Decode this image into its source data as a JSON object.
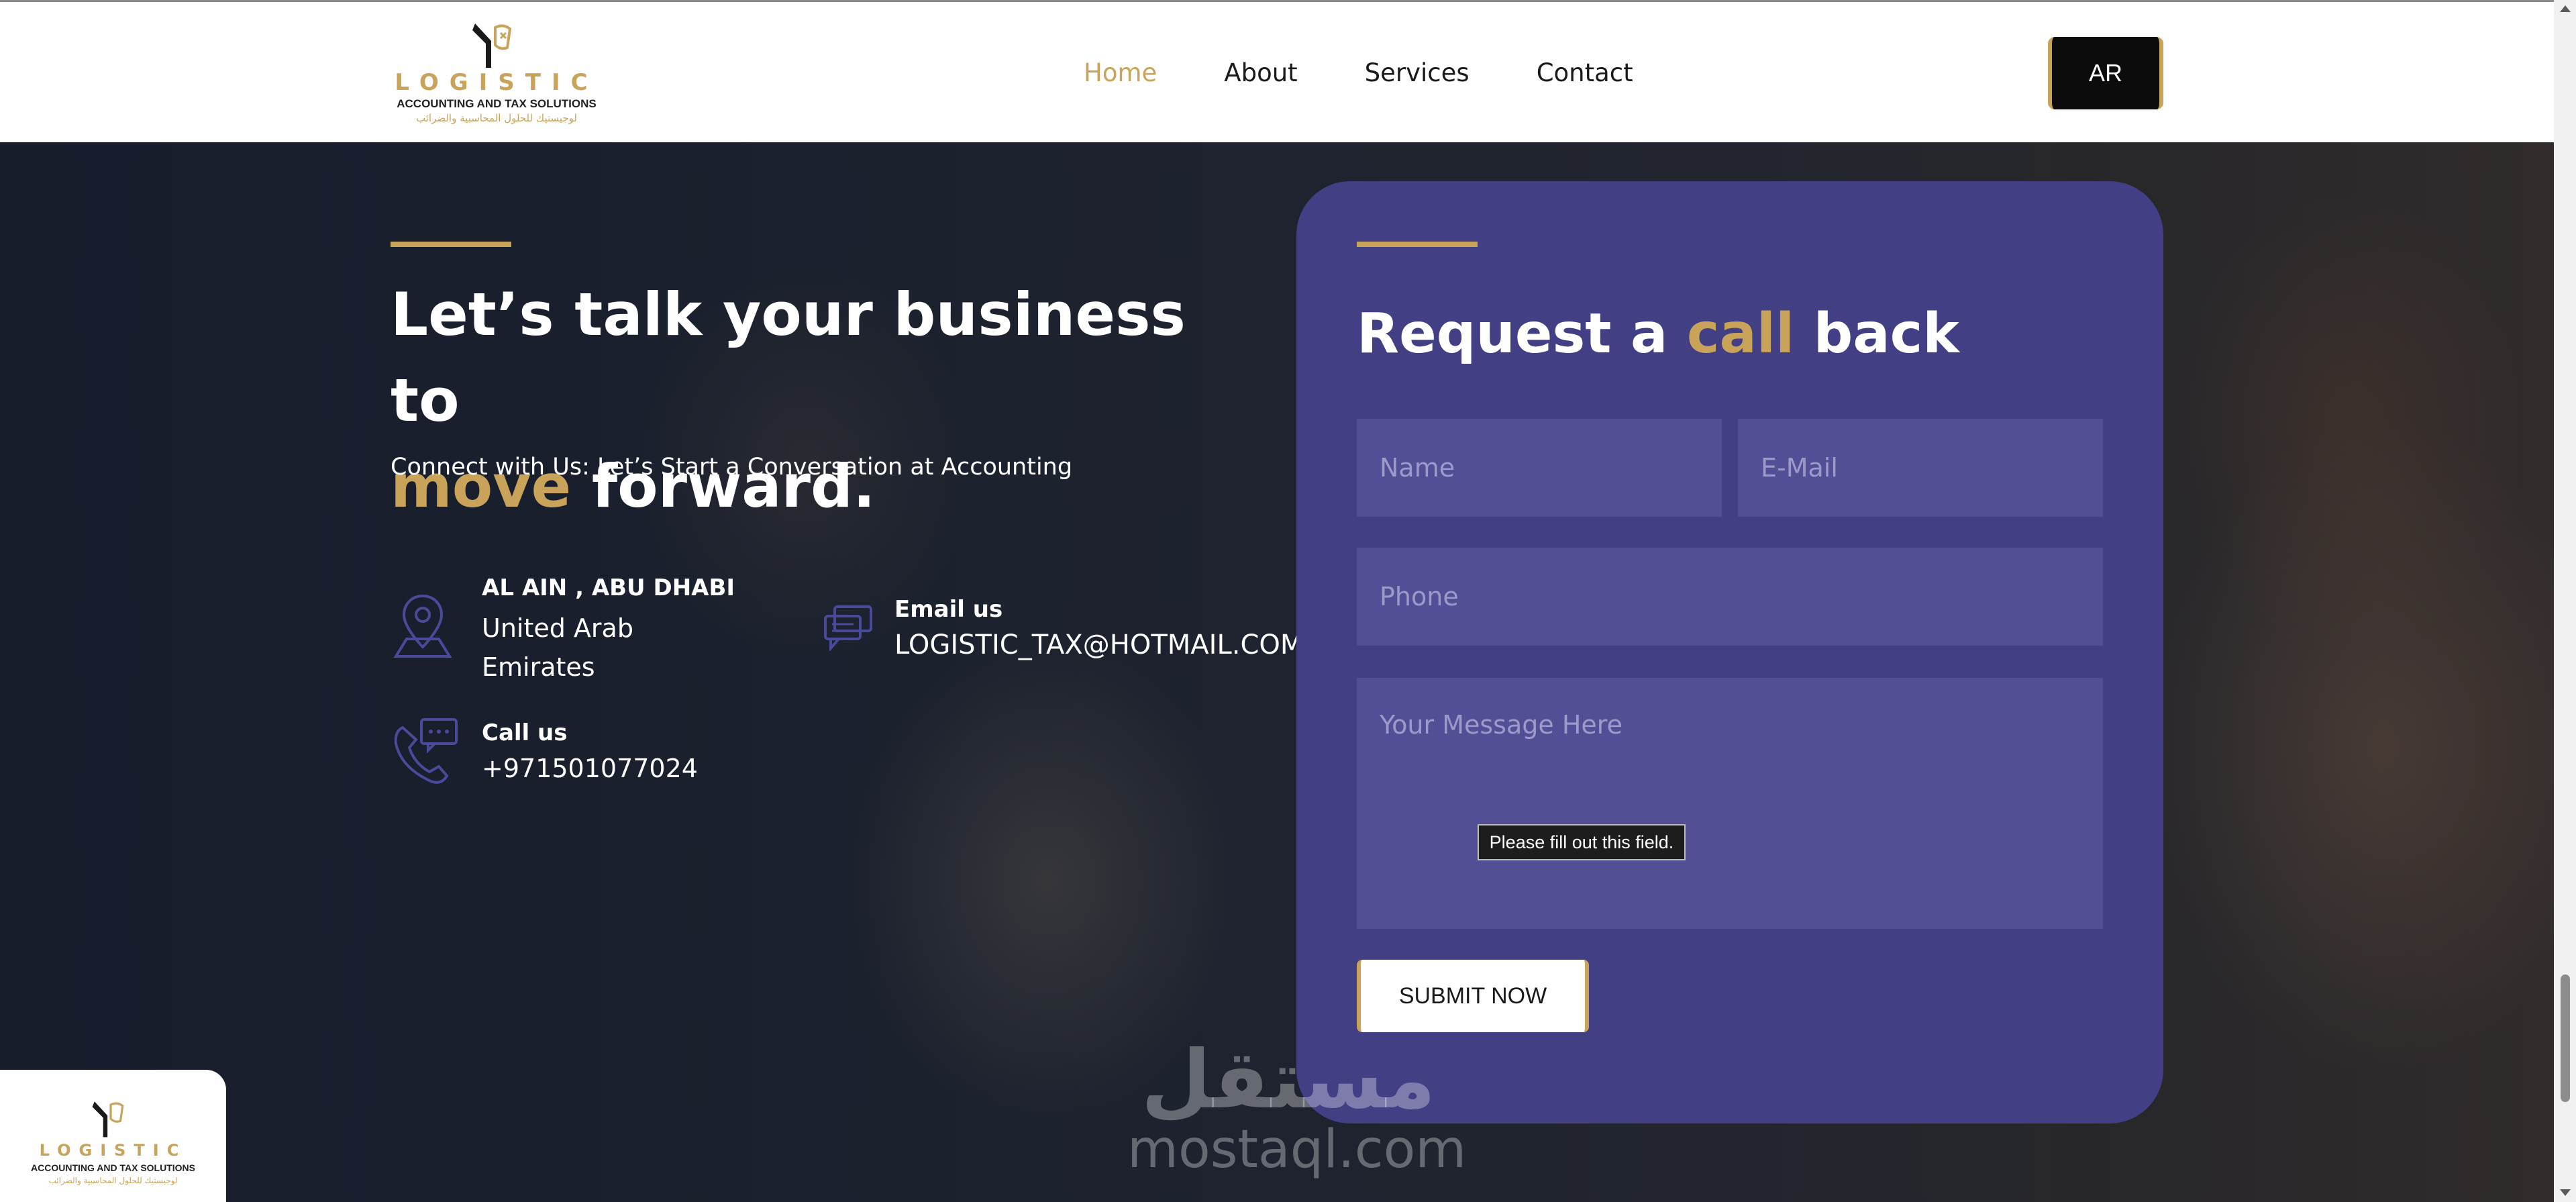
{
  "header": {
    "logo": {
      "word": "LOGISTIC",
      "subtitle": "ACCOUNTING AND TAX SOLUTIONS",
      "arabic": "لوجيستيك للحلول المحاسبية والضرائب"
    },
    "nav": [
      {
        "label": "Home",
        "active": true
      },
      {
        "label": "About",
        "active": false
      },
      {
        "label": "Services",
        "active": false
      },
      {
        "label": "Contact",
        "active": false
      }
    ],
    "lang_button": "AR"
  },
  "hero": {
    "heading_line1": "Let’s talk your business to",
    "heading_accent": "move",
    "heading_rest": " forward.",
    "subheading": "Connect with Us: Let’s Start a Conversation at Accounting",
    "address": {
      "title": "AL AIN , ABU DHABI",
      "line1": "United Arab",
      "line2": "Emirates",
      "icon": "map-pin-icon"
    },
    "email": {
      "title": "Email us",
      "value": "LOGISTIC_TAX@HOTMAIL.COM",
      "icon": "chat-bubbles-icon"
    },
    "phone": {
      "title": "Call us",
      "value": "+971501077024",
      "icon": "phone-icon"
    }
  },
  "form": {
    "title_pre": "Request a ",
    "title_accent": "call",
    "title_post": " back",
    "name_placeholder": "Name",
    "email_placeholder": "E-Mail",
    "phone_placeholder": "Phone",
    "message_placeholder": "Your Message Here",
    "validation_tooltip": "Please fill out this field.",
    "submit_label": "SUBMIT NOW"
  },
  "watermark": {
    "arabic": "مستقل",
    "latin": "mostaql.com"
  },
  "floating_logo": {
    "word": "LOGISTIC",
    "subtitle": "ACCOUNTING AND TAX SOLUTIONS",
    "arabic": "لوجيستيك للحلول المحاسبية والضرائب"
  },
  "colors": {
    "accent_gold": "#c9a35a",
    "card_purple": "#423f85",
    "field_purple": "#524f96",
    "dark_button": "#0c0c0c"
  }
}
